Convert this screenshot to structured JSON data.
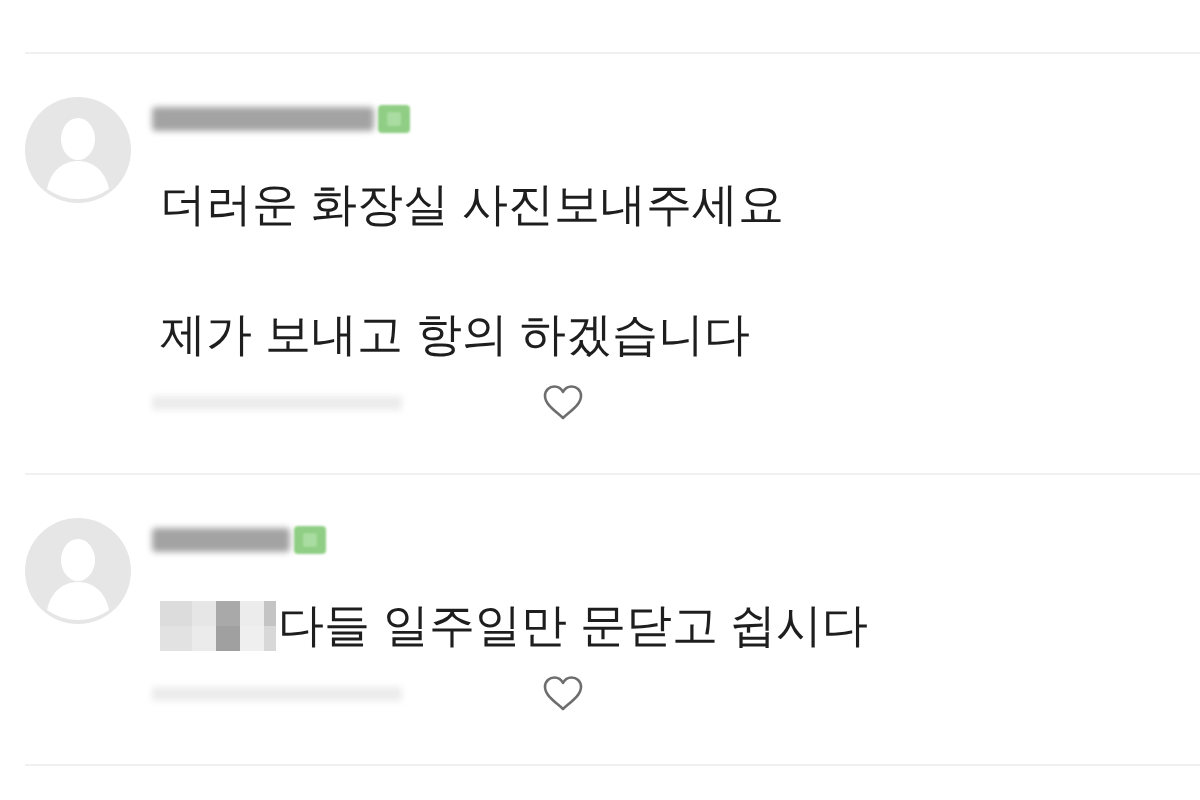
{
  "comments": [
    {
      "mosaic_before_text": false,
      "text": "더러운 화장실 사진보내주세요\n\n제가 보내고 항의 하겠습니다",
      "liked": false
    },
    {
      "mosaic_before_text": true,
      "text": "다들 일주일만 문닫고 쉽시다",
      "liked": false
    }
  ]
}
